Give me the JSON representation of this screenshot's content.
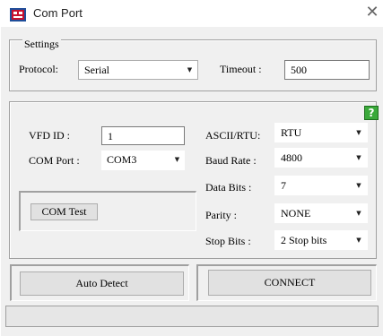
{
  "window": {
    "title": "Com Port",
    "close_glyph": "✕",
    "app_icon": "app-logo-icon"
  },
  "settings": {
    "caption": "Settings",
    "protocol_label": "Protocol:",
    "protocol_value": "Serial",
    "timeout_label": "Timeout :",
    "timeout_value": "500"
  },
  "device": {
    "vfd_id_label": "VFD ID :",
    "vfd_id_value": "1",
    "com_port_label": "COM Port :",
    "com_port_value": "COM3",
    "com_test_label": "COM Test",
    "help_glyph": "?",
    "ascii_rtu_label": "ASCII/RTU:",
    "ascii_rtu_value": "RTU",
    "baud_rate_label": "Baud Rate :",
    "baud_rate_value": "4800",
    "data_bits_label": "Data Bits :",
    "data_bits_value": "7",
    "parity_label": "Parity :",
    "parity_value": "NONE",
    "stop_bits_label": "Stop Bits :",
    "stop_bits_value": "2 Stop bits"
  },
  "actions": {
    "auto_detect_label": "Auto Detect",
    "connect_label": "CONNECT"
  },
  "icons": {
    "dropdown": "▼",
    "colors": {
      "help_green": "#3aa93a",
      "app_icon_red": "#c8102e"
    }
  }
}
